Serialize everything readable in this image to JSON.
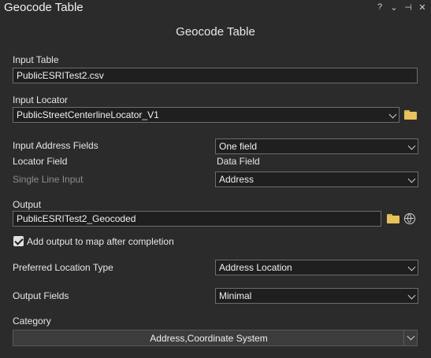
{
  "window": {
    "title": "Geocode Table",
    "controls": [
      "?",
      "⌄",
      "⊣",
      "✕"
    ]
  },
  "panel": {
    "heading": "Geocode Table"
  },
  "input_table": {
    "label": "Input Table",
    "value": "PublicESRITest2.csv"
  },
  "input_locator": {
    "label": "Input Locator",
    "value": "PublicStreetCenterlineLocator_V1"
  },
  "address_fields": {
    "label": "Input Address Fields",
    "value": "One field"
  },
  "field_headers": {
    "locator": "Locator Field",
    "data": "Data Field"
  },
  "single_line": {
    "label": "Single Line Input",
    "value": "Address"
  },
  "output": {
    "label": "Output",
    "value": "PublicESRITest2_Geocoded"
  },
  "add_to_map": {
    "label": "Add output to map after completion",
    "checked": true
  },
  "preferred_location": {
    "label": "Preferred Location Type",
    "value": "Address Location"
  },
  "output_fields": {
    "label": "Output Fields",
    "value": "Minimal"
  },
  "category": {
    "label": "Category",
    "value": "Address,Coordinate System"
  },
  "icons": {
    "folder": "folder-icon",
    "globe": "globe-icon",
    "chevron": "chevron-down-icon"
  },
  "colors": {
    "background": "#2b2b2b",
    "field_bg": "#1f1f1f",
    "folder": "#e8c25a"
  }
}
